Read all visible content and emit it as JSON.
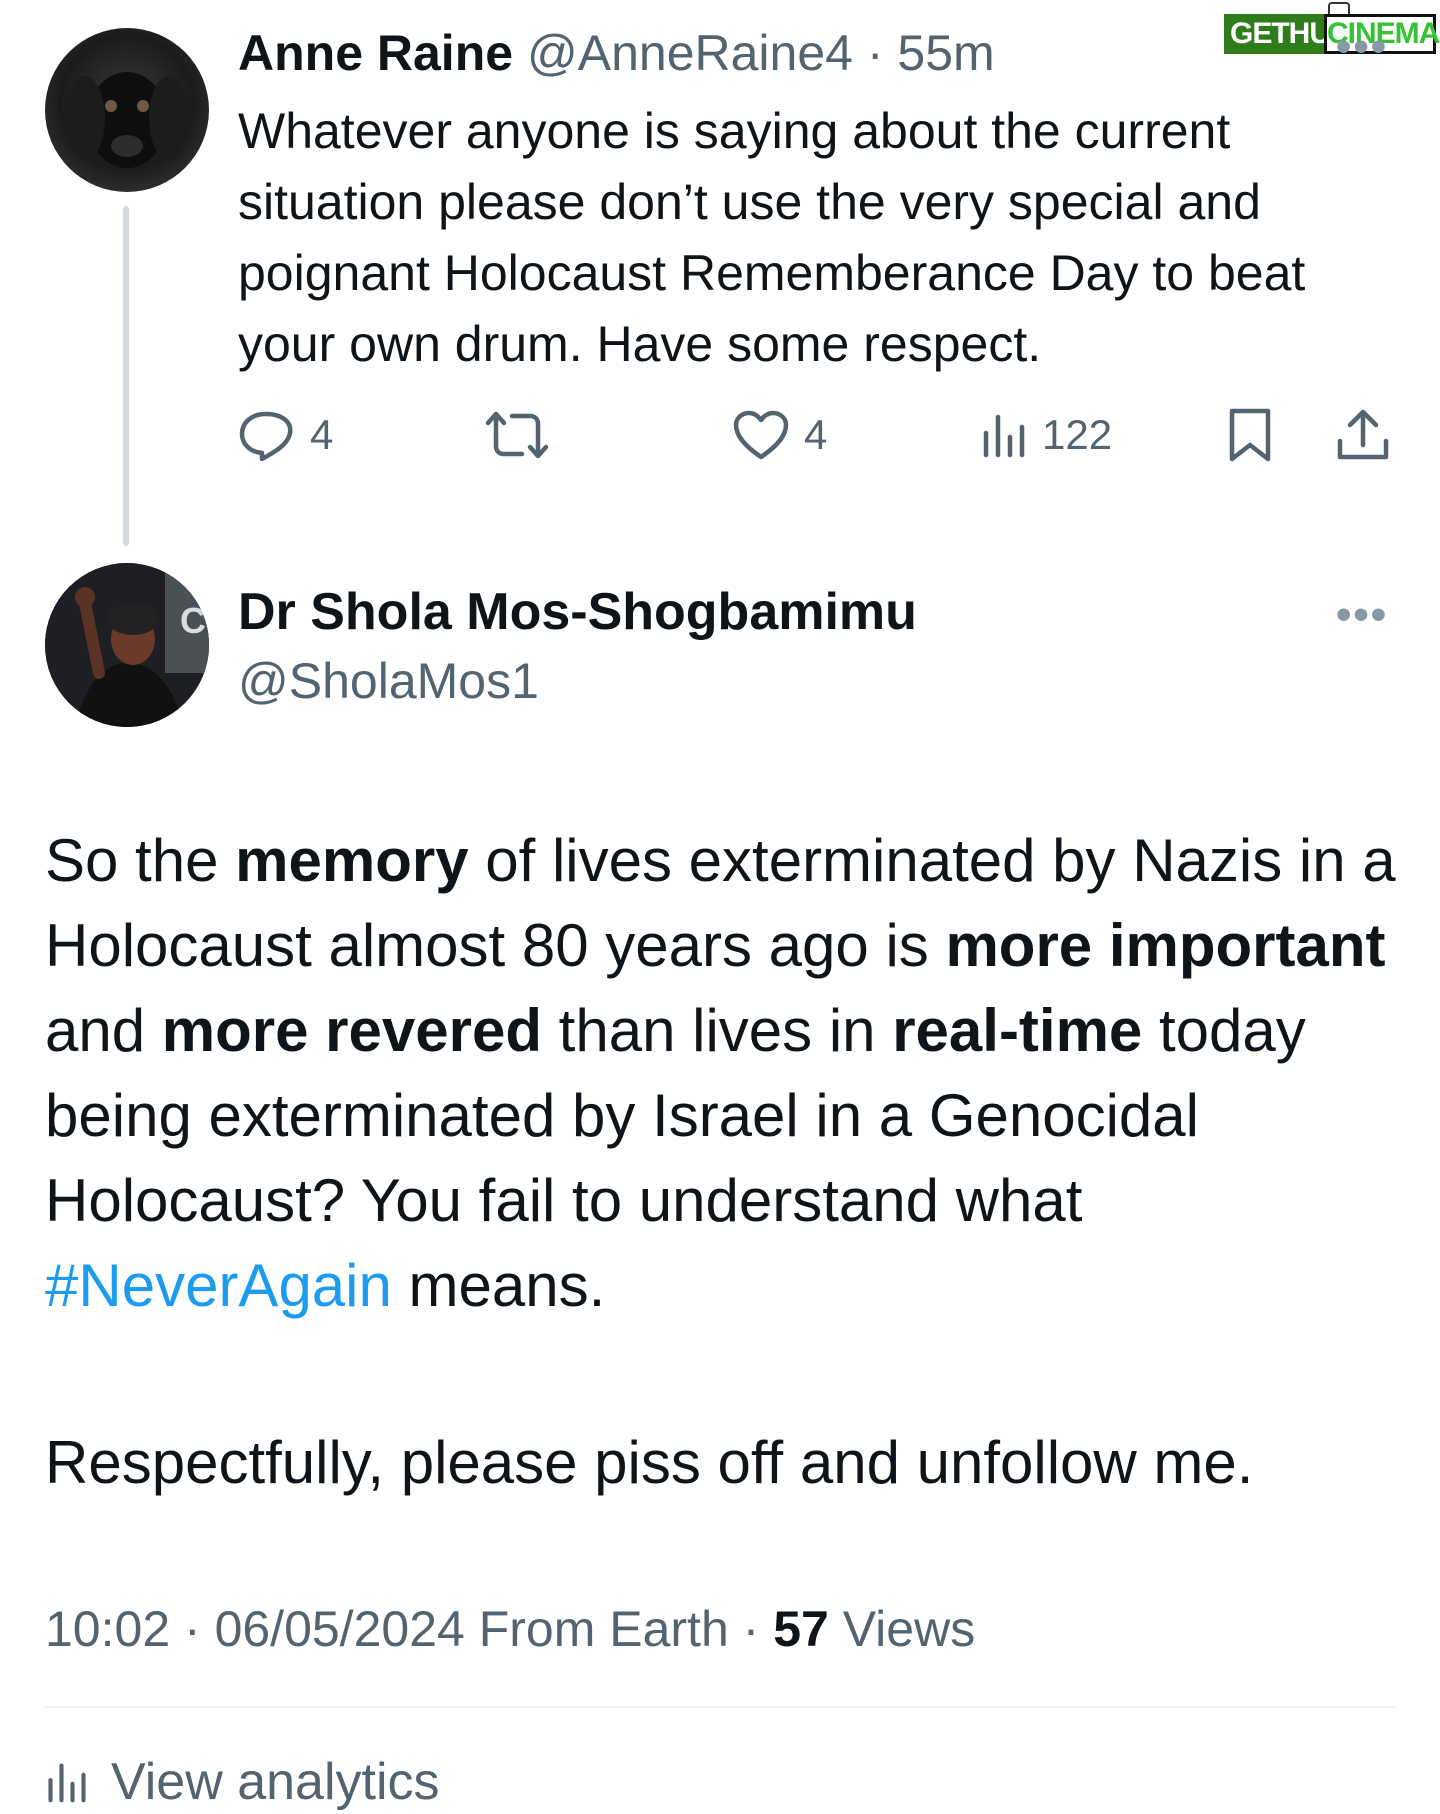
{
  "watermark": {
    "left": "GETHU",
    "right": "CINEMA"
  },
  "reply_tweet": {
    "author_name": "Anne Raine",
    "author_handle": "@AnneRaine4",
    "separator": "·",
    "time_ago": "55m",
    "text": "Whatever anyone is saying about the current situation please don’t use the very special and poignant Holocaust Rememberance Day to beat your own drum. Have some respect.",
    "actions": {
      "reply_count": "4",
      "repost_count": "",
      "like_count": "4",
      "views_count": "122"
    },
    "icons": [
      "reply-icon",
      "repost-icon",
      "like-icon",
      "views-icon",
      "bookmark-icon",
      "share-icon"
    ]
  },
  "main_tweet": {
    "author_name": "Dr Shola Mos-Shogbamimu",
    "author_handle": "@SholaMos1",
    "body": {
      "p1": "So the ",
      "b1": "memory",
      "p2": " of lives exterminated by Nazis in a Holocaust almost 80 years ago is ",
      "b2": "more important",
      "p3": " and ",
      "b3": "more revered",
      "p4": " than lives in ",
      "b4": "real-time",
      "p5": " today being exterminated by Israel in a Genocidal Holocaust? You fail to understand what ",
      "hashtag": "#NeverAgain",
      "p6": " means."
    },
    "closing": "Respectfully, please piss off and unfollow me.",
    "meta": {
      "time": "10:02",
      "sep1": " · ",
      "date": "06/05/2024",
      "source": " From Earth",
      "sep2": " · ",
      "views_count": "57",
      "views_label": " Views"
    },
    "analytics_label": "View analytics"
  },
  "colors": {
    "text": "#0f1419",
    "secondary": "#536471",
    "link": "#1d9bf0",
    "thread_line": "#cfd9de"
  }
}
